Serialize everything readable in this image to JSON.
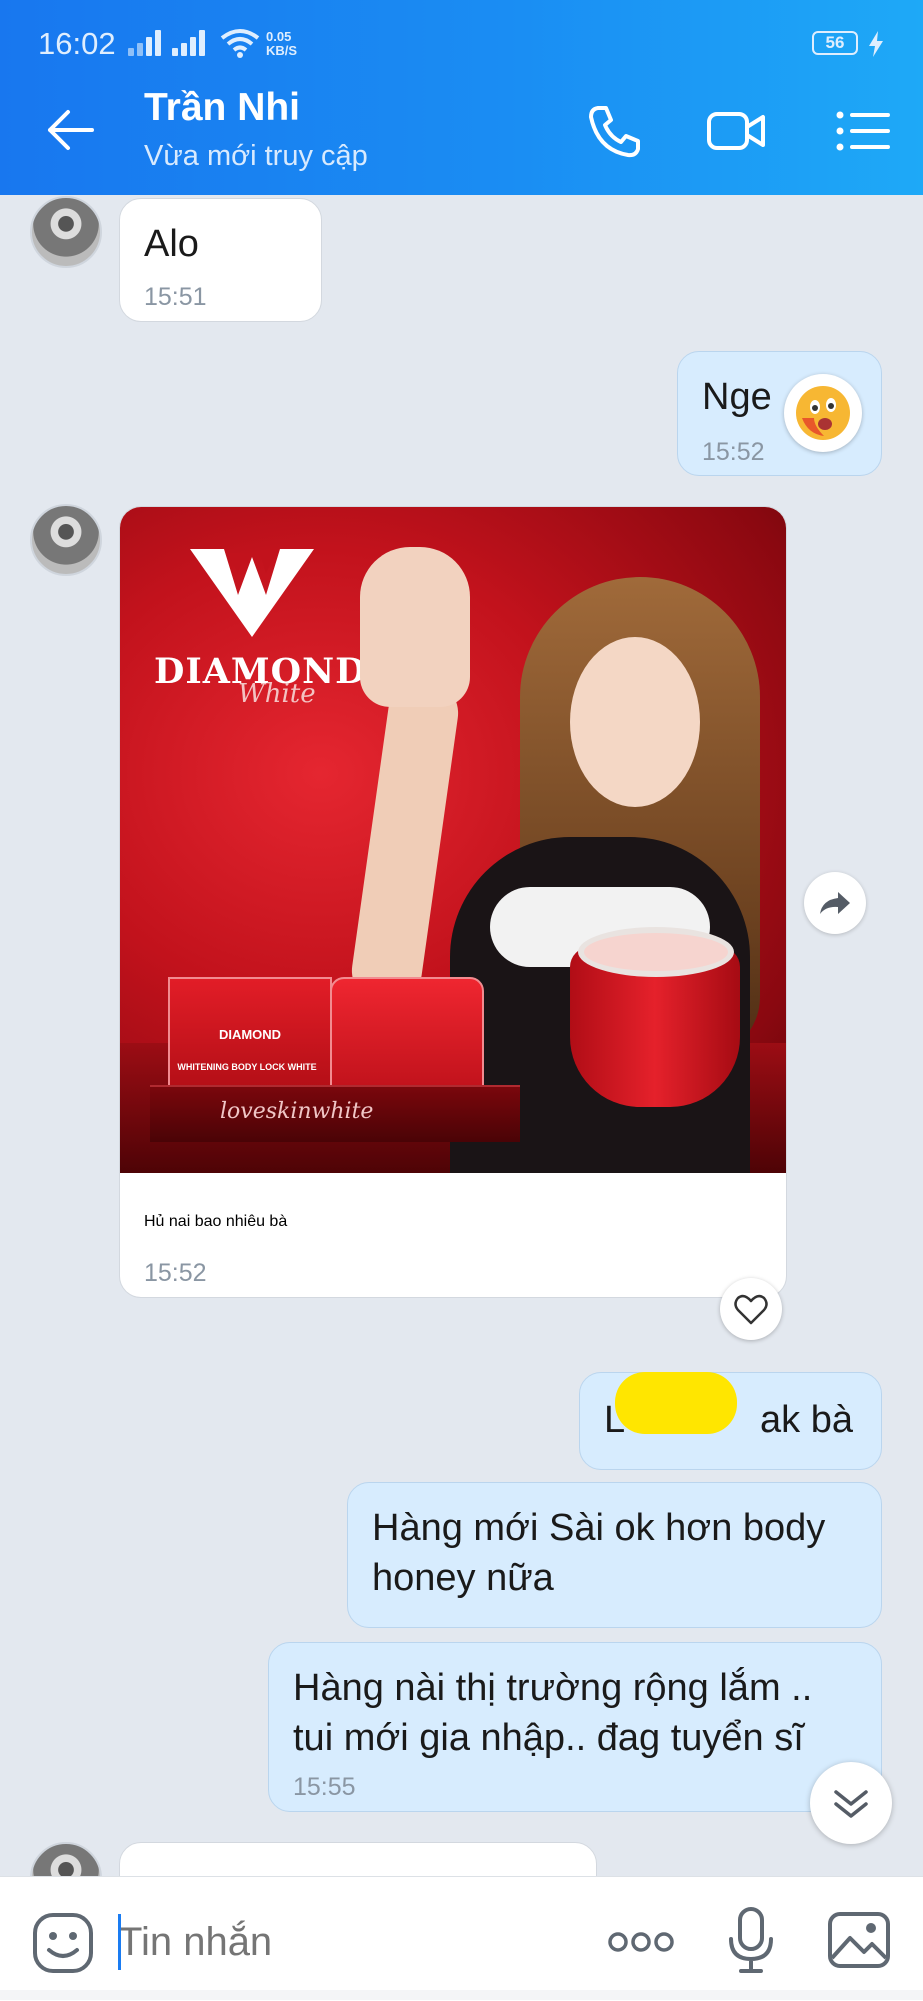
{
  "status_bar": {
    "time": "16:02",
    "net_speed_value": "0.05",
    "net_speed_unit": "KB/S",
    "battery": "56"
  },
  "header": {
    "contact_name": "Trần Nhi",
    "contact_status": "Vừa mới truy cập"
  },
  "messages": [
    {
      "side": "in",
      "text": "Alo",
      "time": "15:51"
    },
    {
      "side": "out",
      "text": "Nge",
      "time": "15:52"
    },
    {
      "side": "in",
      "type": "image",
      "caption": "Hủ nai bao nhiêu bà",
      "time": "15:52",
      "image": {
        "brand": "DIAMOND",
        "brand_sub": "White",
        "tray_text": "loveskinwhite",
        "box_label": "DIAMOND",
        "box_sublabel": "WHITENING BODY LOCK WHITE"
      }
    },
    {
      "side": "out",
      "text_start": "L",
      "text_end": "ak bà",
      "redacted": true
    },
    {
      "side": "out",
      "text": "Hàng mới Sài ok hơn body honey nữa"
    },
    {
      "side": "out",
      "line1": "Hàng nài thị trường rộng lắm ..",
      "line2": "tui mới gia nhập.. đag tuyển sĩ",
      "time": "15:55"
    }
  ],
  "input": {
    "placeholder": "Tin nhắn",
    "more_label": "ooo"
  },
  "colors": {
    "header_start": "#1877ef",
    "header_end": "#1ea9f7",
    "chat_bg": "#e3e8ef",
    "out_bubble": "#d7ecfe",
    "in_bubble": "#ffffff",
    "caret": "#1a7cf2"
  },
  "icons": [
    "back-arrow-icon",
    "phone-icon",
    "video-call-icon",
    "menu-list-icon",
    "forward-icon",
    "heart-icon",
    "chevron-double-down-icon",
    "sticker-icon",
    "more-icon",
    "microphone-icon",
    "image-icon"
  ]
}
